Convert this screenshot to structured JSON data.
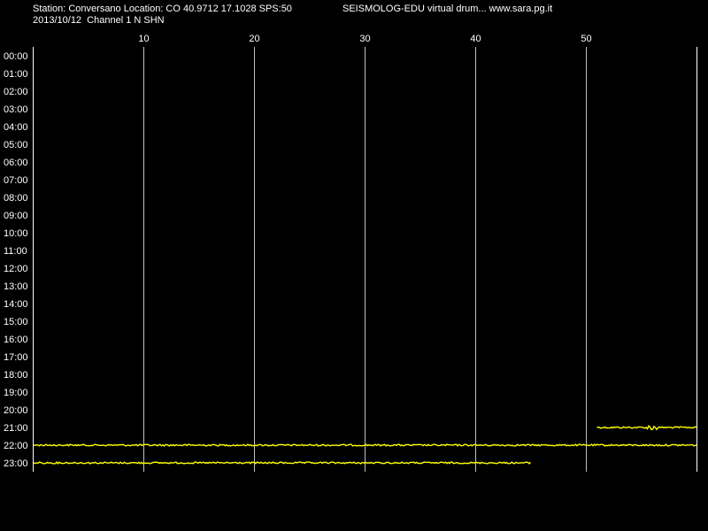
{
  "header": {
    "station_line": "Station: Conversano Location: CO 40.9712 17.1028 SPS:50",
    "title_line": "SEISMOLOG-EDU virtual drum... www.sara.pg.it",
    "date_line": "2013/10/12  Channel 1 N SHN"
  },
  "chart_data": {
    "type": "line",
    "x_ticks": [
      10,
      20,
      30,
      40,
      50
    ],
    "xlim": [
      0,
      60
    ],
    "y_labels": [
      "00:00",
      "01:00",
      "02:00",
      "03:00",
      "04:00",
      "05:00",
      "06:00",
      "07:00",
      "08:00",
      "09:00",
      "10:00",
      "11:00",
      "12:00",
      "13:00",
      "14:00",
      "15:00",
      "16:00",
      "17:00",
      "18:00",
      "19:00",
      "20:00",
      "21:00",
      "22:00",
      "23:00"
    ],
    "grid_vertical": true,
    "colors": {
      "background": "#000000",
      "axis": "#ffffff",
      "grid": "#c0c0c0",
      "trace": "#ffff00"
    },
    "series": [
      {
        "hour_row": 21,
        "x_start": 51,
        "x_end": 60,
        "event_at": 56
      },
      {
        "hour_row": 22,
        "x_start": 0,
        "x_end": 60
      },
      {
        "hour_row": 23,
        "x_start": 0,
        "x_end": 45
      }
    ]
  }
}
